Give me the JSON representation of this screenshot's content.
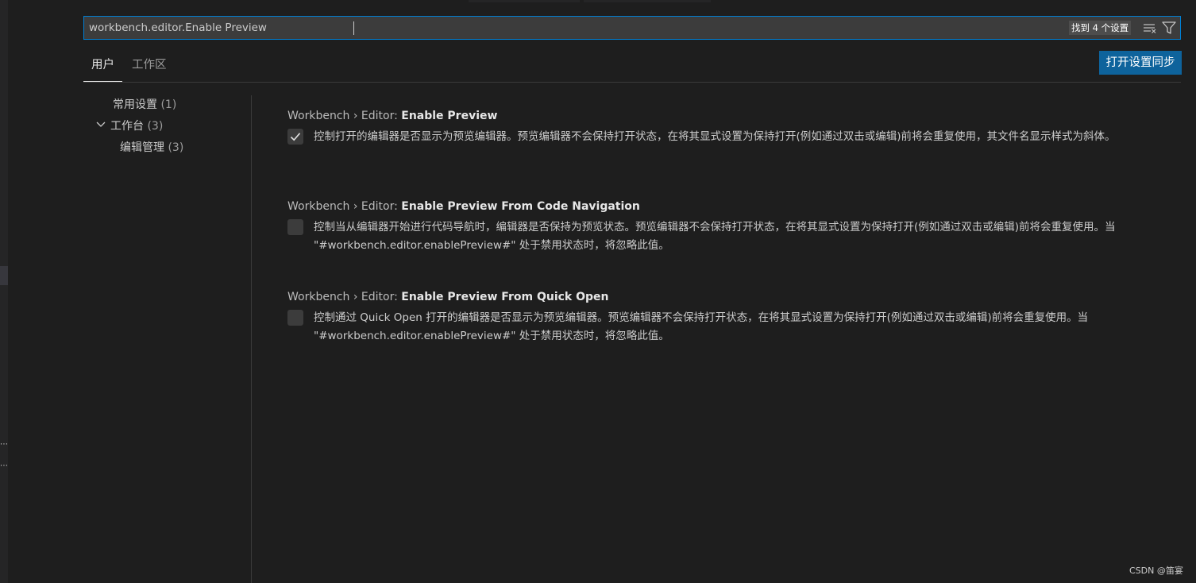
{
  "search": {
    "value": "workbench.editor.Enable Preview",
    "result_count": "找到 4 个设置"
  },
  "icons": {
    "clear_filter": "clear-filter-icon",
    "filter": "filter-icon",
    "checkmark": "check-icon",
    "chevron": "chevron-down-icon"
  },
  "tabs": [
    {
      "label": "用户",
      "active": true
    },
    {
      "label": "工作区",
      "active": false
    }
  ],
  "sync_button": "打开设置同步",
  "toc": [
    {
      "label": "常用设置",
      "count": "(1)"
    },
    {
      "label": "工作台",
      "count": "(3)"
    },
    {
      "label": "编辑管理",
      "count": "(3)"
    }
  ],
  "settings": [
    {
      "category": "Workbench › Editor: ",
      "name": "Enable Preview",
      "checked": true,
      "description": "控制打开的编辑器是否显示为预览编辑器。预览编辑器不会保持打开状态，在将其显式设置为保持打开(例如通过双击或编辑)前将会重复使用，其文件名显示样式为斜体。"
    },
    {
      "category": "Workbench › Editor: ",
      "name": "Enable Preview From Code Navigation",
      "checked": false,
      "description": "控制当从编辑器开始进行代码导航时，编辑器是否保持为预览状态。预览编辑器不会保持打开状态，在将其显式设置为保持打开(例如通过双击或编辑)前将会重复使用。当 \"#workbench.editor.enablePreview#\" 处于禁用状态时，将忽略此值。"
    },
    {
      "category": "Workbench › Editor: ",
      "name": "Enable Preview From Quick Open",
      "checked": false,
      "description": "控制通过 Quick Open 打开的编辑器是否显示为预览编辑器。预览编辑器不会保持打开状态，在将其显式设置为保持打开(例如通过双击或编辑)前将会重复使用。当 \"#workbench.editor.enablePreview#\" 处于禁用状态时，将忽略此值。"
    }
  ],
  "watermark": "CSDN @笛宴",
  "colors": {
    "background": "#1e1e1e",
    "accent": "#007fd4",
    "button": "#0e639c"
  }
}
